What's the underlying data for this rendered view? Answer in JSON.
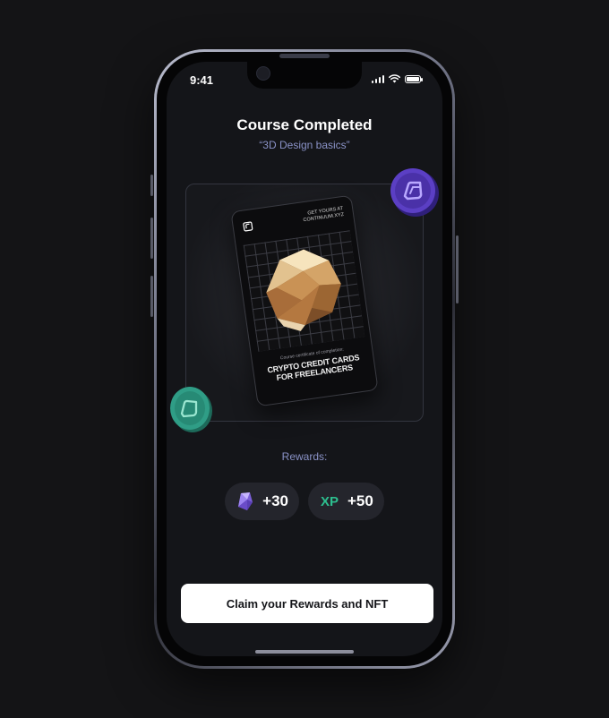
{
  "status_bar": {
    "time": "9:41"
  },
  "header": {
    "title": "Course Completed",
    "subtitle": "“3D Design basics”"
  },
  "certificate_card": {
    "promo_line1": "GET YOURS AT",
    "promo_line2": "CONTINUUM.XYZ",
    "caption": "Course certificate of completion:",
    "course_name_line1": "CRYPTO CREDIT CARDS",
    "course_name_line2": "FOR FREELANCERS"
  },
  "rewards": {
    "label": "Rewards:",
    "gem_reward": "+30",
    "xp_label": "XP",
    "xp_reward": "+50"
  },
  "actions": {
    "claim_label": "Claim your Rewards and NFT"
  },
  "colors": {
    "background": "#141416",
    "screen": "#141519",
    "accent_text": "#8a92c7",
    "xp_green": "#2dbf8f",
    "coin_purple": "#5b3fc4",
    "coin_teal": "#2f9d86"
  },
  "icons": {
    "gem": "purple-crystal-icon",
    "coin_purple": "purple-coin-icon",
    "coin_teal": "teal-coin-icon"
  }
}
